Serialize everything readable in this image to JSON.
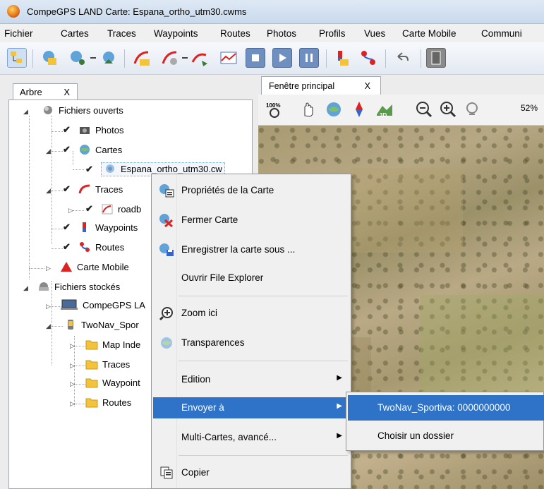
{
  "window": {
    "title": "CompeGPS LAND Carte: Espana_ortho_utm30.cwms"
  },
  "menu": [
    "Fichier",
    "Cartes",
    "Traces",
    "Waypoints",
    "Routes",
    "Photos",
    "Profils",
    "Vues",
    "Carte Mobile",
    "Communi"
  ],
  "left_tab": {
    "label": "Arbre",
    "close": "X"
  },
  "tree": {
    "open_files": "Fichiers ouverts",
    "photos": "Photos",
    "cartes": "Cartes",
    "map_file": "Espana_ortho_utm30.cw",
    "traces": "Traces",
    "trace_file": "roadb",
    "waypoints": "Waypoints",
    "routes": "Routes",
    "carte_mobile": "Carte Mobile",
    "stored_files": "Fichiers stockés",
    "compegps": "CompeGPS LA",
    "twonav": "TwoNav_Spor",
    "folders": [
      "Map Inde",
      "Traces",
      "Waypoint",
      "Routes"
    ]
  },
  "map_tab": {
    "label": "Fenêtre principal",
    "close": "X"
  },
  "map_zoom": "52%",
  "context_menu": {
    "items": [
      {
        "label": "Propriétés de la Carte",
        "icon": "map-properties-icon"
      },
      {
        "label": "Fermer Carte",
        "icon": "close-map-icon"
      },
      {
        "label": "Enregistrer la carte sous ...",
        "icon": "save-map-icon"
      },
      {
        "label": "Ouvrir File Explorer",
        "icon": ""
      },
      {
        "label": "Zoom ici",
        "icon": "zoom-icon"
      },
      {
        "label": "Transparences",
        "icon": "transparency-icon"
      },
      {
        "label": "Edition",
        "icon": "",
        "submenu": true
      },
      {
        "label": "Envoyer à",
        "icon": "",
        "submenu": true,
        "highlighted": true
      },
      {
        "label": "Multi-Cartes, avancé...",
        "icon": "",
        "submenu": true
      },
      {
        "label": "Copier",
        "icon": "copy-icon"
      }
    ]
  },
  "submenu": {
    "items": [
      {
        "label": "TwoNav_Sportiva: 0000000000",
        "highlighted": true
      },
      {
        "label": "Choisir un dossier"
      }
    ]
  },
  "colors": {
    "highlight": "#2f73c9",
    "menu_bg": "#f0f0f0"
  }
}
